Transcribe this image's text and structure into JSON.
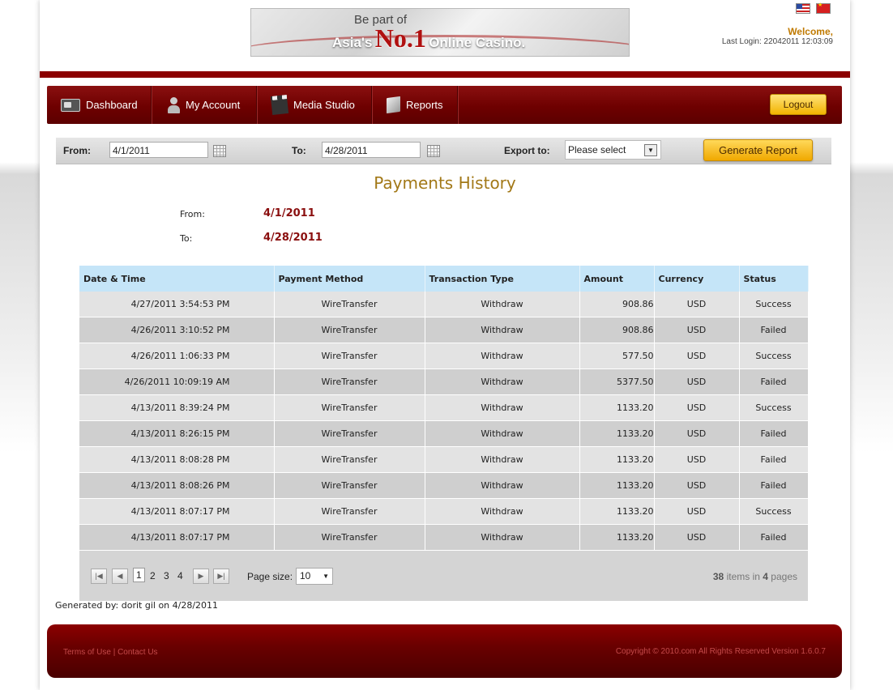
{
  "banner": {
    "line1": "Be part of",
    "asia": "Asia's",
    "no1": "No.1",
    "casino": "Online Casino."
  },
  "user": {
    "welcome": "Welcome,",
    "last_login": "Last Login: 22042011 12:03:09"
  },
  "nav": {
    "items": [
      {
        "label": "Dashboard",
        "icon": "dashboard-icon"
      },
      {
        "label": "My Account",
        "icon": "user-icon"
      },
      {
        "label": "Media Studio",
        "icon": "clapperboard-icon"
      },
      {
        "label": "Reports",
        "icon": "report-icon"
      }
    ],
    "logout": "Logout"
  },
  "filter": {
    "from_label": "From:",
    "from_value": "4/1/2011",
    "to_label": "To:",
    "to_value": "4/28/2011",
    "export_label": "Export to:",
    "export_value": "Please select",
    "generate": "Generate Report"
  },
  "report": {
    "title": "Payments History",
    "from_label": "From:",
    "from_value": "4/1/2011",
    "to_label": "To:",
    "to_value": "4/28/2011"
  },
  "table": {
    "headers": [
      "Date & Time",
      "Payment Method",
      "Transaction Type",
      "Amount",
      "Currency",
      "Status"
    ],
    "rows": [
      [
        "4/27/2011 3:54:53 PM",
        "WireTransfer",
        "Withdraw",
        "908.86",
        "USD",
        "Success"
      ],
      [
        "4/26/2011 3:10:52 PM",
        "WireTransfer",
        "Withdraw",
        "908.86",
        "USD",
        "Failed"
      ],
      [
        "4/26/2011 1:06:33 PM",
        "WireTransfer",
        "Withdraw",
        "577.50",
        "USD",
        "Success"
      ],
      [
        "4/26/2011 10:09:19 AM",
        "WireTransfer",
        "Withdraw",
        "5377.50",
        "USD",
        "Failed"
      ],
      [
        "4/13/2011 8:39:24 PM",
        "WireTransfer",
        "Withdraw",
        "1133.20",
        "USD",
        "Success"
      ],
      [
        "4/13/2011 8:26:15 PM",
        "WireTransfer",
        "Withdraw",
        "1133.20",
        "USD",
        "Failed"
      ],
      [
        "4/13/2011 8:08:28 PM",
        "WireTransfer",
        "Withdraw",
        "1133.20",
        "USD",
        "Failed"
      ],
      [
        "4/13/2011 8:08:26 PM",
        "WireTransfer",
        "Withdraw",
        "1133.20",
        "USD",
        "Failed"
      ],
      [
        "4/13/2011 8:07:17 PM",
        "WireTransfer",
        "Withdraw",
        "1133.20",
        "USD",
        "Success"
      ],
      [
        "4/13/2011 8:07:17 PM",
        "WireTransfer",
        "Withdraw",
        "1133.20",
        "USD",
        "Failed"
      ]
    ]
  },
  "pager": {
    "pages": [
      "1",
      "2",
      "3",
      "4"
    ],
    "current": "1",
    "page_size_label": "Page size:",
    "page_size": "10",
    "items_total": "38",
    "items_mid": "items in",
    "pages_total": "4",
    "pages_word": "pages"
  },
  "generated_by": "Generated by: dorit gil on 4/28/2011",
  "footer": {
    "terms": "Terms of Use",
    "separator": "|",
    "contact": "Contact Us",
    "copyright": "Copyright © 2010.com All Rights Reserved  Version 1.6.0.7"
  },
  "colors": {
    "nav_red": "#6e0000",
    "accent_gold": "#f2b400",
    "header_blue": "#c5e5f8",
    "title_gold": "#a27817",
    "range_red": "#8a0e0e"
  }
}
